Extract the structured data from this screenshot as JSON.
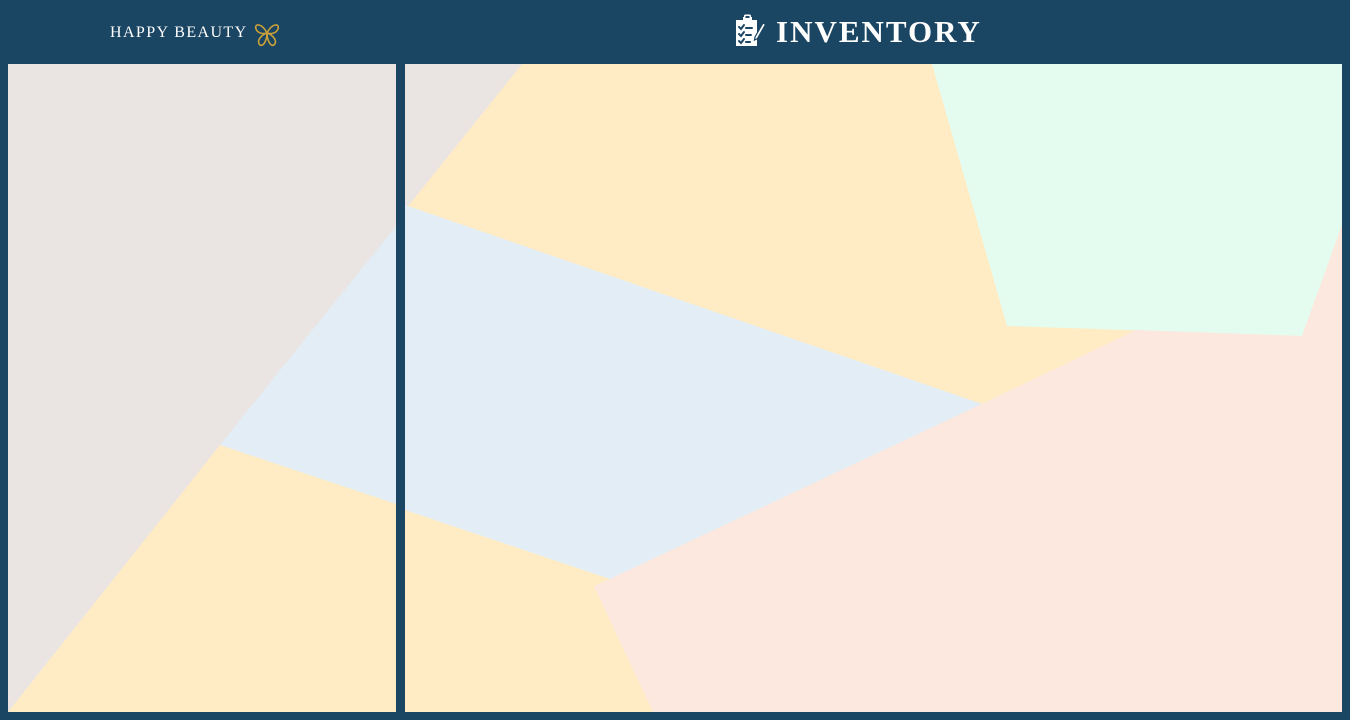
{
  "header": {
    "brand": {
      "name": "HAPPY BEAUTY",
      "logo_icon": "butterfly-icon",
      "logo_color": "#c9a13a"
    },
    "title": "INVENTORY",
    "title_icon": "clipboard-checklist-icon"
  },
  "colors": {
    "frame": "#1a4563",
    "header_text": "#ffffff",
    "region_taupe": "#eae4e2",
    "region_cream": "#ffecc5",
    "region_blue": "#e2edf5",
    "region_mint": "#e3fcef",
    "region_peach": "#fde8e0"
  },
  "panels": {
    "left": {
      "content": "decorative-background"
    },
    "right": {
      "content": "decorative-background"
    }
  }
}
